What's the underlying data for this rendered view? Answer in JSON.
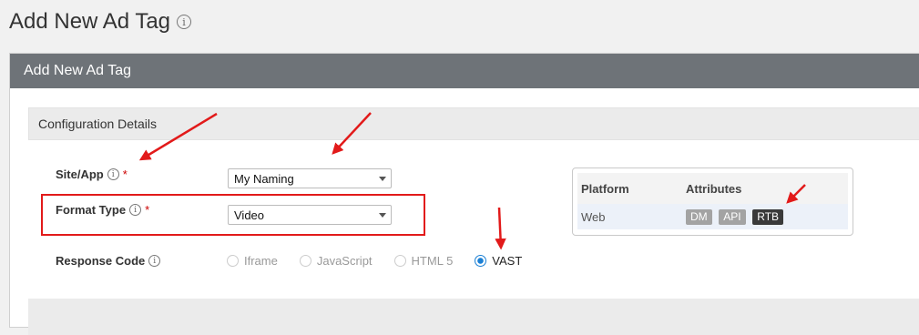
{
  "page": {
    "title": "Add New Ad Tag"
  },
  "panel": {
    "header": "Add New Ad Tag",
    "section_title": "Configuration Details"
  },
  "form": {
    "site_app": {
      "label": "Site/App",
      "required_mark": "*",
      "value": "My Naming"
    },
    "format_type": {
      "label": "Format Type",
      "required_mark": "*",
      "value": "Video"
    },
    "response_code": {
      "label": "Response Code",
      "options": [
        {
          "label": "Iframe",
          "state": "disabled"
        },
        {
          "label": "JavaScript",
          "state": "disabled"
        },
        {
          "label": "HTML 5",
          "state": "disabled"
        },
        {
          "label": "VAST",
          "state": "checked"
        }
      ]
    }
  },
  "platform_table": {
    "headers": [
      "Platform",
      "Attributes"
    ],
    "rows": [
      {
        "platform": "Web",
        "attributes": [
          "DM",
          "API",
          "RTB"
        ]
      }
    ]
  },
  "colors": {
    "panel_header": "#6e7378",
    "annotation_red": "#e21a1a",
    "radio_checked": "#1a7fd4",
    "badge_light": "#a3a3a3",
    "badge_dark": "#3a3a3a"
  }
}
